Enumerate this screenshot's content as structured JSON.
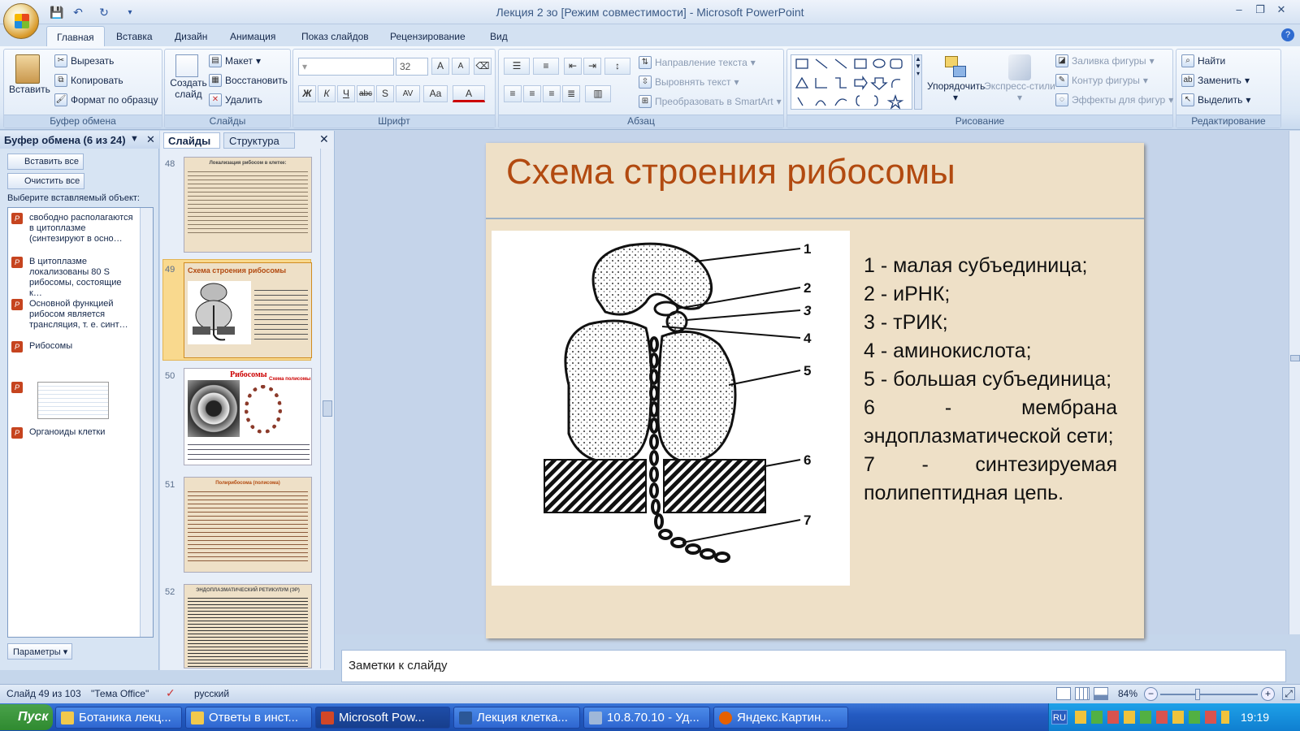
{
  "window": {
    "title": "Лекция 2 зо [Режим совместимости] - Microsoft PowerPoint",
    "help_glyph": "?"
  },
  "tabs": [
    "Главная",
    "Вставка",
    "Дизайн",
    "Анимация",
    "Показ слайдов",
    "Рецензирование",
    "Вид"
  ],
  "ribbon": {
    "clipboard": {
      "label": "Буфер обмена",
      "paste": "Вставить",
      "cut": "Вырезать",
      "copy": "Копировать",
      "format_painter": "Формат по образцу"
    },
    "slides": {
      "label": "Слайды",
      "new_slide": "Создать слайд",
      "layout": "Макет",
      "reset": "Восстановить",
      "delete": "Удалить"
    },
    "font": {
      "label": "Шрифт",
      "size": "32"
    },
    "paragraph": {
      "label": "Абзац",
      "text_direction": "Направление текста",
      "align_text": "Выровнять текст",
      "smartart": "Преобразовать в SmartArt"
    },
    "drawing": {
      "label": "Рисование",
      "arrange": "Упорядочить",
      "quick_styles": "Экспресс-стили",
      "shape_fill": "Заливка фигуры",
      "shape_outline": "Контур фигуры",
      "shape_effects": "Эффекты для фигур"
    },
    "editing": {
      "label": "Редактирование",
      "find": "Найти",
      "replace": "Заменить",
      "select": "Выделить"
    }
  },
  "clipboard_pane": {
    "title": "Буфер обмена (6 из 24)",
    "paste_all": "Вставить все",
    "clear_all": "Очистить все",
    "prompt": "Выберите вставляемый объект:",
    "items": [
      "свободно располагаются в цитоплазме (синтезируют в осно…",
      "В цитоплазме локализованы 80 S рибосомы, состоящие к…",
      "Основной функцией рибосом является трансляция, т. е. синт…",
      "Рибосомы",
      "",
      "Органоиды клетки"
    ],
    "options": "Параметры"
  },
  "slides_pane": {
    "tab_slides": "Слайды",
    "tab_outline": "Структура",
    "thumbs": [
      {
        "num": "48",
        "title": "Локализация рибосом в клетке:"
      },
      {
        "num": "49",
        "title": "Схема строения рибосомы"
      },
      {
        "num": "50",
        "title": "Рибосомы",
        "subtitle": "Схема полисомы"
      },
      {
        "num": "51",
        "title": "Полирибосома (полисома)"
      },
      {
        "num": "52",
        "title": "ЭНДОПЛАЗМАТИЧЕСКИЙ РЕТИКУЛУМ (ЭР)"
      }
    ]
  },
  "slide": {
    "title": "Схема строения рибосомы",
    "legend": [
      "1 - малая субъединица;",
      "2 - иРНК;",
      "3 - тРИК;",
      "4 - аминокислота;",
      "5 - большая субъединица;",
      "6 - мембрана эндоплазматической сети;",
      "7 - синтезируемая полипептидная цепь."
    ],
    "diagram_labels": [
      "1",
      "2",
      "3",
      "4",
      "5",
      "6",
      "7"
    ]
  },
  "notes_placeholder": "Заметки к слайду",
  "status": {
    "slide": "Слайд 49 из 103",
    "theme": "\"Тема Office\"",
    "language": "русский",
    "zoom": "84%"
  },
  "taskbar": {
    "start": "Пуск",
    "tasks": [
      "Ботаника лекц...",
      "Ответы в инст...",
      "Microsoft Pow...",
      "Лекция клетка...",
      "10.8.70.10 - Уд...",
      "Яндекс.Картин..."
    ],
    "lang": "RU",
    "clock": "19:19"
  }
}
